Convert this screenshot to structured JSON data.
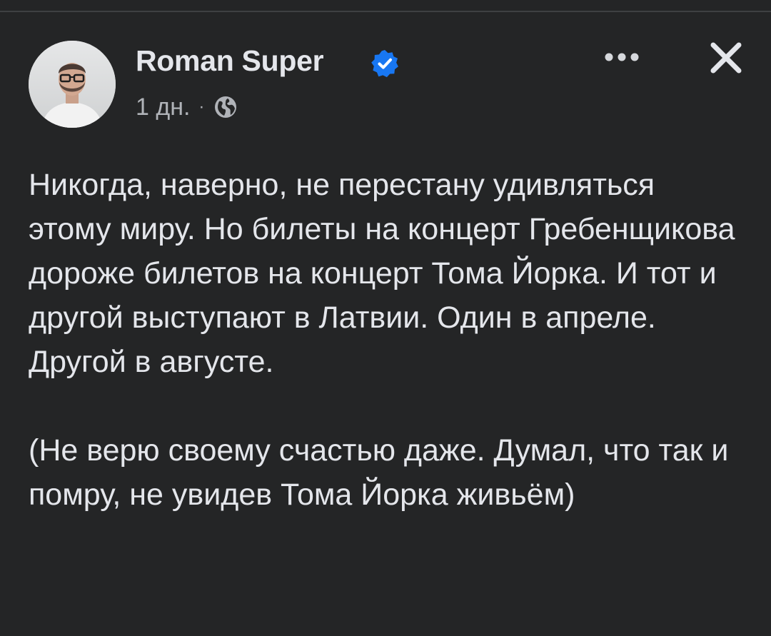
{
  "post": {
    "author_name": "Roman Super",
    "verified": true,
    "timestamp": "1 дн.",
    "separator": "·",
    "audience_icon": "globe-icon",
    "more_icon": "more-horizontal-icon",
    "close_icon": "close-icon",
    "paragraphs": [
      "Никогда, наверно, не перестану удивляться этому миру. Но билеты на концерт Гребенщикова дороже билетов на концерт Тома Йорка. И тот и другой выступают в Латвии. Один в апреле. Другой в августе.",
      "(Не верю своему счастью даже. Думал, что так и помру, не увидев Тома Йорка живьём)"
    ]
  },
  "colors": {
    "background": "#242526",
    "primary_text": "#e4e6eb",
    "secondary_text": "#b0b3b8",
    "verified_blue": "#1877f2"
  }
}
